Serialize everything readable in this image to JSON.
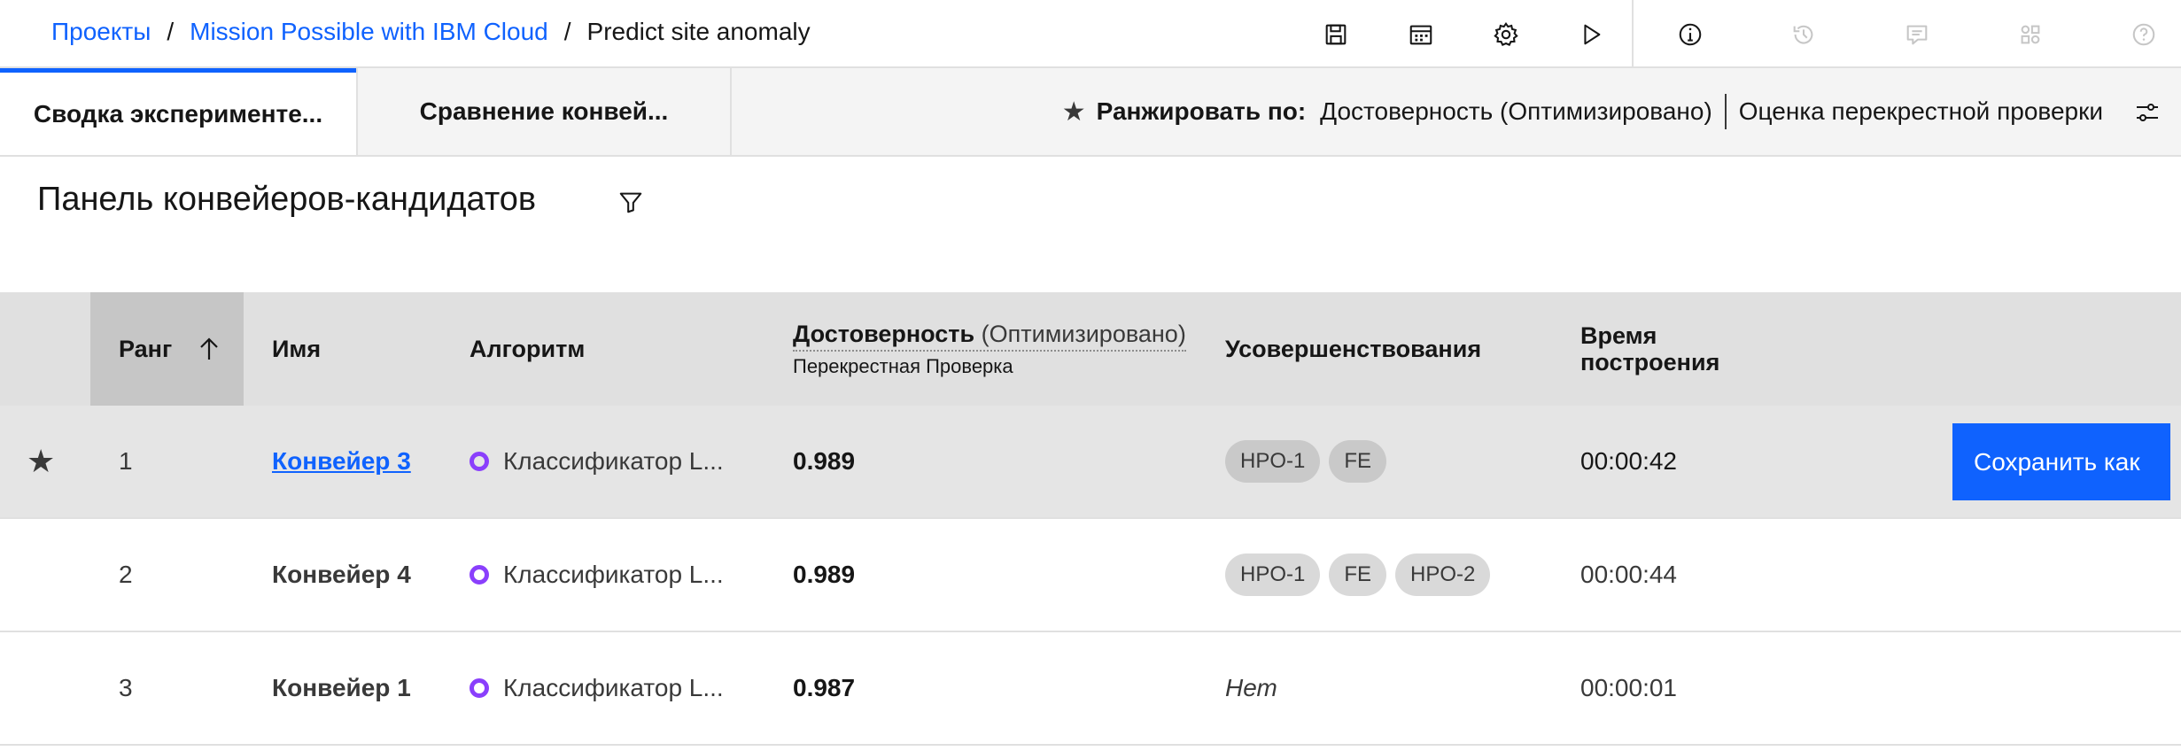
{
  "breadcrumb": {
    "items": [
      "Проекты",
      "Mission Possible with IBM Cloud"
    ],
    "current": "Predict site anomaly",
    "separator": "/"
  },
  "toolbar": {
    "icons": [
      "save-icon",
      "calendar-icon",
      "settings-icon",
      "run-icon",
      "info-icon",
      "history-icon",
      "comment-icon",
      "apps-icon",
      "help-icon"
    ]
  },
  "tabs": [
    {
      "label": "Сводка эксперименте...",
      "active": true
    },
    {
      "label": "Сравнение конвей...",
      "active": false
    }
  ],
  "rank_by": {
    "label": "Ранжировать по:",
    "metric": "Достоверность (Оптимизировано)",
    "method": "Оценка перекрестной проверки"
  },
  "panel": {
    "title": "Панель конвейеров-кандидатов"
  },
  "table": {
    "headers": {
      "rank": "Ранг",
      "name": "Имя",
      "algorithm": "Алгоритм",
      "accuracy": "Достоверность",
      "accuracy_optimized": "(Оптимизировано)",
      "accuracy_sub": "Перекрестная Проверка",
      "enhancements": "Усовершенствования",
      "build_time_line1": "Время",
      "build_time_line2": "построения"
    },
    "rows": [
      {
        "rank": "1",
        "name": "Конвейер 3",
        "algorithm": "Классификатор L...",
        "accuracy": "0.989",
        "enhancements": [
          "HPO-1",
          "FE"
        ],
        "build_time": "00:00:42",
        "starred": true,
        "selected": true,
        "action": "Сохранить как"
      },
      {
        "rank": "2",
        "name": "Конвейер 4",
        "algorithm": "Классификатор L...",
        "accuracy": "0.989",
        "enhancements": [
          "HPO-1",
          "FE",
          "HPO-2"
        ],
        "build_time": "00:00:44",
        "starred": false,
        "selected": false
      },
      {
        "rank": "3",
        "name": "Конвейер 1",
        "algorithm": "Классификатор L...",
        "accuracy": "0.987",
        "enhancements_none": "Нет",
        "build_time": "00:00:01",
        "starred": false,
        "selected": false
      }
    ]
  },
  "colors": {
    "accent": "#0f62fe",
    "algorithm_dot": "#8a3ffc",
    "header_bg": "#e0e0e0",
    "selected_row_bg": "#e5e5e5"
  }
}
